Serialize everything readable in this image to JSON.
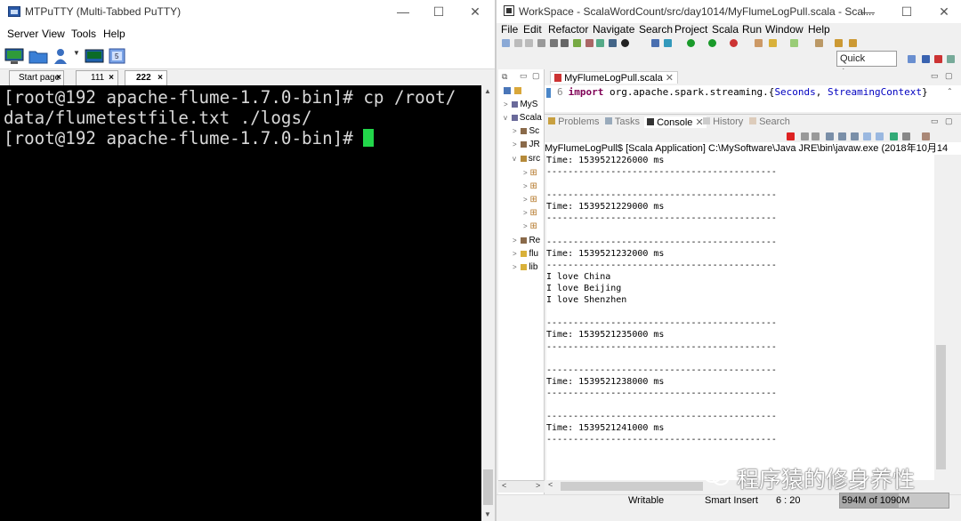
{
  "putty": {
    "title": "MTPuTTY (Multi-Tabbed PuTTY)",
    "menu": [
      "Server",
      "View",
      "Tools",
      "Help"
    ],
    "tabs": [
      {
        "label": "Start page",
        "close": "×"
      },
      {
        "label": "111",
        "close": "×"
      },
      {
        "label": "222",
        "close": "×"
      }
    ],
    "terminal_lines": [
      "[root@192 apache-flume-1.7.0-bin]# cp /root/",
      "data/flumetestfile.txt ./logs/",
      "[root@192 apache-flume-1.7.0-bin]# "
    ],
    "window_buttons": [
      "—",
      "☐",
      "✕"
    ]
  },
  "eclipse": {
    "title": "WorkSpace - ScalaWordCount/src/day1014/MyFlumeLogPull.scala - Scal...",
    "menu": [
      "File",
      "Edit",
      "Refactor",
      "Navigate",
      "Search",
      "Project",
      "Scala",
      "Run",
      "Window",
      "Help"
    ],
    "quick_access": "Quick Access",
    "window_buttons": [
      "—",
      "☐",
      "✕"
    ],
    "package_explorer": [
      {
        "arrow": ">",
        "label": "MyS"
      },
      {
        "arrow": "v",
        "label": "Scala"
      },
      {
        "arrow": ">",
        "label": "Sc"
      },
      {
        "arrow": ">",
        "label": "JR"
      },
      {
        "arrow": "v",
        "label": "src"
      },
      {
        "arrow": ">",
        "label": "⊞"
      },
      {
        "arrow": ">",
        "label": "⊞"
      },
      {
        "arrow": ">",
        "label": "⊞"
      },
      {
        "arrow": ">",
        "label": "⊞"
      },
      {
        "arrow": ">",
        "label": "⊞"
      },
      {
        "arrow": ">",
        "label": "Re"
      },
      {
        "arrow": ">",
        "label": "flu"
      },
      {
        "arrow": ">",
        "label": "lib"
      }
    ],
    "editor_tab": "MyFlumeLogPull.scala",
    "code": {
      "line_no": "6",
      "keyword": "import",
      "pkg": " org.apache.spark.streaming.{",
      "cls1": "Seconds",
      "sep": ", ",
      "cls2": "StreamingContext",
      "end": "}"
    },
    "console_tabs": [
      {
        "label": "Problems",
        "active": false
      },
      {
        "label": "Tasks",
        "active": false
      },
      {
        "label": "Console",
        "active": true
      },
      {
        "label": "History",
        "active": false
      },
      {
        "label": "Search",
        "active": false
      }
    ],
    "console_desc": "MyFlumeLogPull$ [Scala Application] C:\\MySoftware\\Java JRE\\bin\\javaw.exe (2018年10月14",
    "console_lines": [
      "Time: 1539521226000 ms",
      "-------------------------------------------",
      "",
      "-------------------------------------------",
      "Time: 1539521229000 ms",
      "-------------------------------------------",
      "",
      "-------------------------------------------",
      "Time: 1539521232000 ms",
      "-------------------------------------------",
      "I love China",
      "I love Beijing",
      "I love Shenzhen",
      "",
      "-------------------------------------------",
      "Time: 1539521235000 ms",
      "-------------------------------------------",
      "",
      "-------------------------------------------",
      "Time: 1539521238000 ms",
      "-------------------------------------------",
      "",
      "-------------------------------------------",
      "Time: 1539521241000 ms",
      "-------------------------------------------"
    ],
    "status": {
      "writable": "Writable",
      "insert_mode": "Smart Insert",
      "position": "6 : 20",
      "heap": "594M of 1090M",
      "heap_used_fraction": 0.545
    }
  },
  "watermark": "程序猿的修身养性"
}
